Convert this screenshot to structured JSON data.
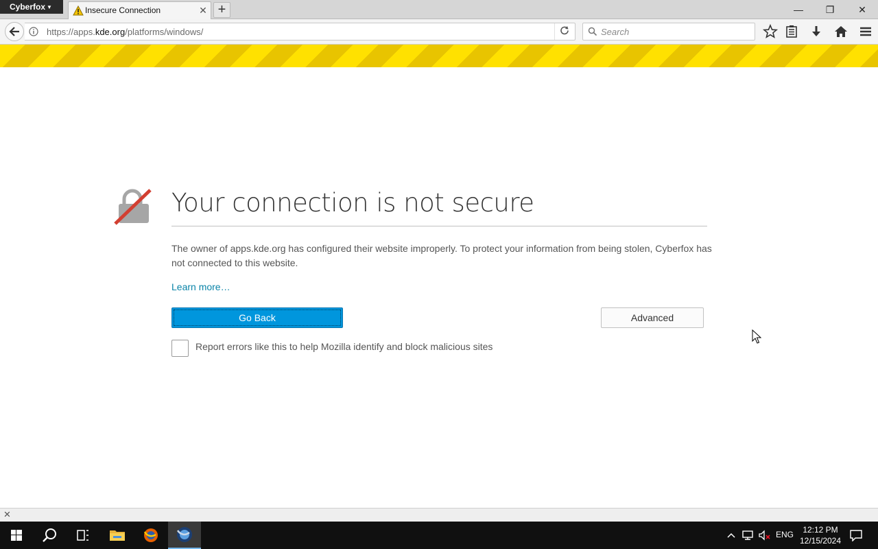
{
  "browser": {
    "app_menu_label": "Cyberfox",
    "tab_title": "Insecure Connection",
    "url_prefix": "https://apps.",
    "url_host": "kde.org",
    "url_path": "/platforms/windows/",
    "search_placeholder": "Search"
  },
  "error_page": {
    "title": "Your connection is not secure",
    "description": "The owner of apps.kde.org has configured their website improperly. To protect your information from being stolen, Cyberfox has not connected to this website.",
    "learn_more": "Learn more…",
    "go_back_label": "Go Back",
    "advanced_label": "Advanced",
    "report_label": "Report errors like this to help Mozilla identify and block malicious sites"
  },
  "taskbar": {
    "language": "ENG",
    "time": "12:12 PM",
    "date": "12/15/2024"
  },
  "colors": {
    "stripe_yellow": "#ffe100",
    "primary_button": "#0096dd",
    "link": "#0a84a8"
  }
}
